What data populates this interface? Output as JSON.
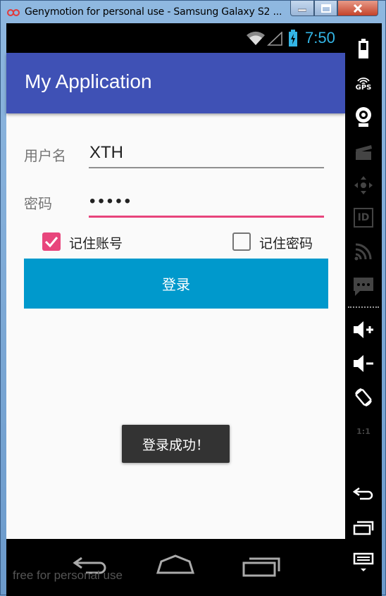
{
  "window": {
    "title": "Genymotion for personal use - Samsung Galaxy S2 ...",
    "minimize_glyph": "—",
    "maximize_glyph": "▢",
    "close_glyph": "✕"
  },
  "statusbar": {
    "time": "7:50",
    "icons": [
      "wifi-icon",
      "signal-icon",
      "battery-icon"
    ]
  },
  "app": {
    "title": "My Application",
    "username_label": "用户名",
    "username_value": "XTH",
    "password_label": "密码",
    "password_value": "•••••",
    "remember_account_label": "记住账号",
    "remember_account_checked": true,
    "remember_password_label": "记住密码",
    "remember_password_checked": false,
    "login_label": "登录",
    "toast_text": "登录成功！"
  },
  "navbar": {
    "watermark": "free for personal use",
    "buttons": [
      "back-icon",
      "home-icon",
      "recents-icon"
    ]
  },
  "sidebar": {
    "items": [
      "battery-icon",
      "gps-icon",
      "webcam-icon",
      "clapper-icon",
      "dpad-icon",
      "id-icon",
      "cast-icon",
      "sms-icon",
      "volume-up-icon",
      "volume-down-icon",
      "rotate-icon",
      "scale-icon",
      "back-icon",
      "recents-icon",
      "menu-icon"
    ],
    "gps_text": "GPS",
    "id_text": "ID",
    "scale_text": "1:1"
  },
  "colors": {
    "primary": "#3f51b5",
    "accent": "#e8457c",
    "button": "#0099cc",
    "clock": "#33b5e5"
  }
}
